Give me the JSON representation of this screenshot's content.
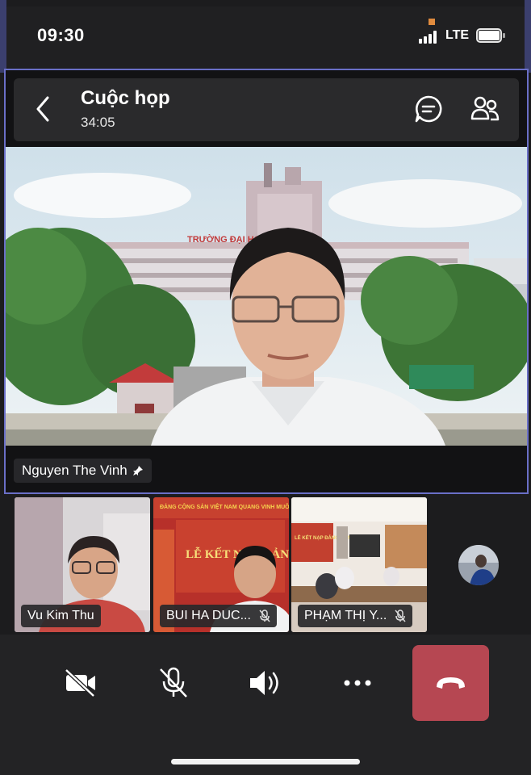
{
  "status_bar": {
    "time": "09:30",
    "network": "LTE"
  },
  "meeting": {
    "title": "Cuộc họp",
    "duration": "34:05"
  },
  "icons": {
    "back": "chevron-left-icon",
    "chat": "chat-bubble-icon",
    "people": "participants-icon",
    "pin": "pin-icon",
    "mute": "mic-off-icon",
    "camera": "video-off-icon",
    "mic": "mic-off-icon",
    "speaker": "speaker-icon",
    "more": "more-icon",
    "end": "end-call-icon"
  },
  "main_speaker": {
    "name": "Nguyen The Vinh",
    "pinned": true,
    "backdrop_text": "TRƯỜNG ĐẠI HỌC ... CHẤT"
  },
  "participants": [
    {
      "name": "Vu Kim Thu",
      "muted": false
    },
    {
      "name": "BUI HA DUC...",
      "muted": true,
      "backdrop_text": "ĐẢNG CỘNG SẢN VIỆT NAM QUANG VINH MUÔN NĂM",
      "banner": "LỄ KẾT NẠ... ĐẢNG VIÊN"
    },
    {
      "name": "PHẠM THỊ Y...",
      "muted": true,
      "backdrop_text": "LỄ KẾT NẠP ĐẢNG VIÊN"
    }
  ],
  "colors": {
    "stage_border": "#6a6fc7",
    "end_call": "#b64752",
    "background": "#1c1c1e"
  }
}
